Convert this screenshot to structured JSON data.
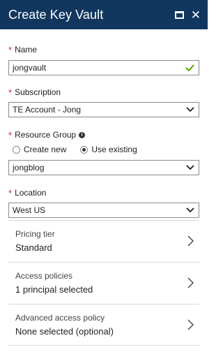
{
  "blade": {
    "title": "Create Key Vault",
    "maximize_icon": "maximize-icon",
    "close_icon": "close-icon",
    "close_glyph": "✕"
  },
  "fields": {
    "name": {
      "required_mark": "*",
      "label": "Name",
      "value": "jongvault",
      "status_icon": "check-icon"
    },
    "subscription": {
      "required_mark": "*",
      "label": "Subscription",
      "value": "TE Account - Jong"
    },
    "resource_group": {
      "required_mark": "*",
      "label": "Resource Group",
      "info_icon": "info-icon",
      "info_glyph": "i",
      "options": [
        "Create new",
        "Use existing"
      ],
      "selected_option": "Use existing",
      "value": "jongblog"
    },
    "location": {
      "required_mark": "*",
      "label": "Location",
      "value": "West US"
    }
  },
  "nav_items": [
    {
      "label": "Pricing tier",
      "value": "Standard"
    },
    {
      "label": "Access policies",
      "value": "1 principal selected"
    },
    {
      "label": "Advanced access policy",
      "value": "None selected (optional)"
    }
  ],
  "colors": {
    "header_bg": "#11375f",
    "required": "#c0282e",
    "valid_check": "#57a300",
    "border": "#8a8a8a"
  }
}
